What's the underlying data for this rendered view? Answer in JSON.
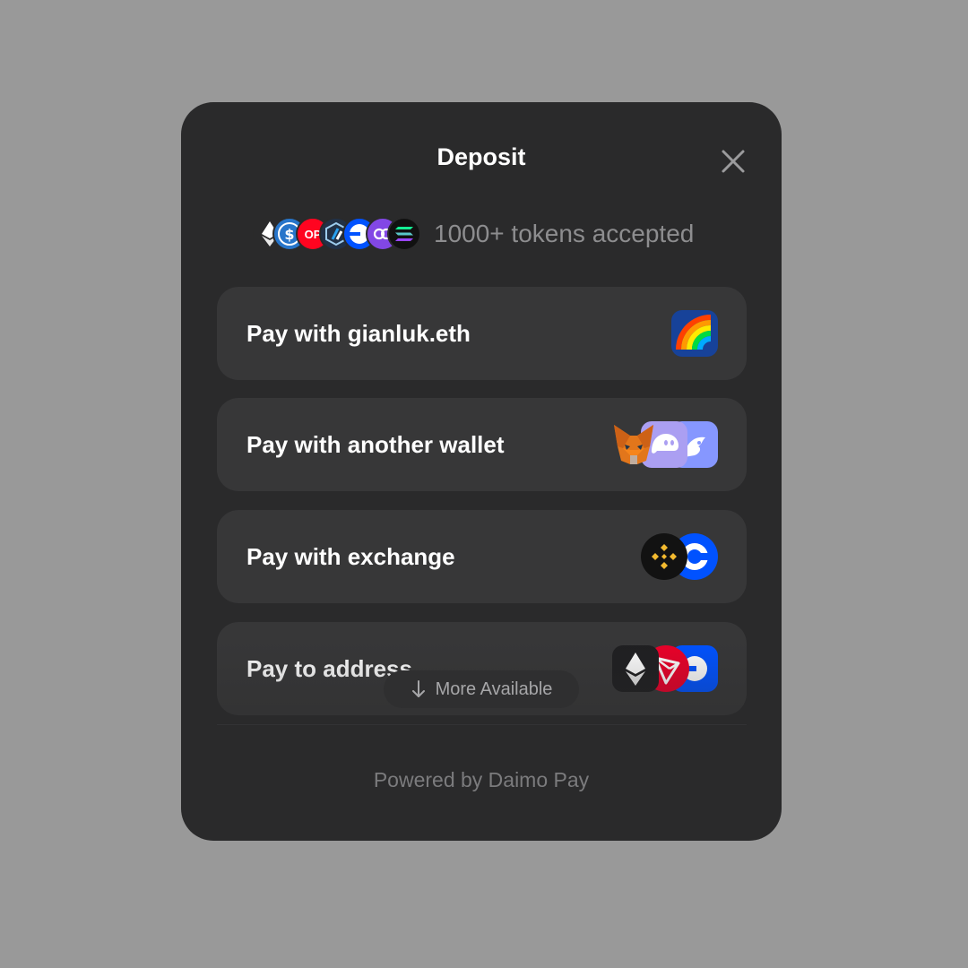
{
  "modal": {
    "title": "Deposit",
    "tokens_text": "1000+ tokens accepted",
    "options": [
      {
        "label": "Pay with gianluk.eth",
        "icons": [
          "rainbow-wallet-icon"
        ]
      },
      {
        "label": "Pay with another wallet",
        "icons": [
          "metamask-icon",
          "phantom-icon",
          "rabby-icon"
        ]
      },
      {
        "label": "Pay with exchange",
        "icons": [
          "binance-icon",
          "coinbase-icon"
        ]
      },
      {
        "label": "Pay to address",
        "icons": [
          "ethereum-icon",
          "tron-icon",
          "base-icon"
        ]
      }
    ],
    "more_label": "More Available",
    "powered_by": "Powered by Daimo Pay"
  },
  "token_icons": [
    "ethereum-icon",
    "usdc-icon",
    "optimism-icon",
    "arbitrum-icon",
    "base-icon",
    "polygon-icon",
    "solana-icon"
  ],
  "token_labels": {
    "optimism": "OP"
  },
  "colors": {
    "background": "#999999",
    "modal": "#2a2a2b",
    "option": "#373738",
    "text_primary": "#ffffff",
    "text_muted": "#8d8d8f"
  }
}
